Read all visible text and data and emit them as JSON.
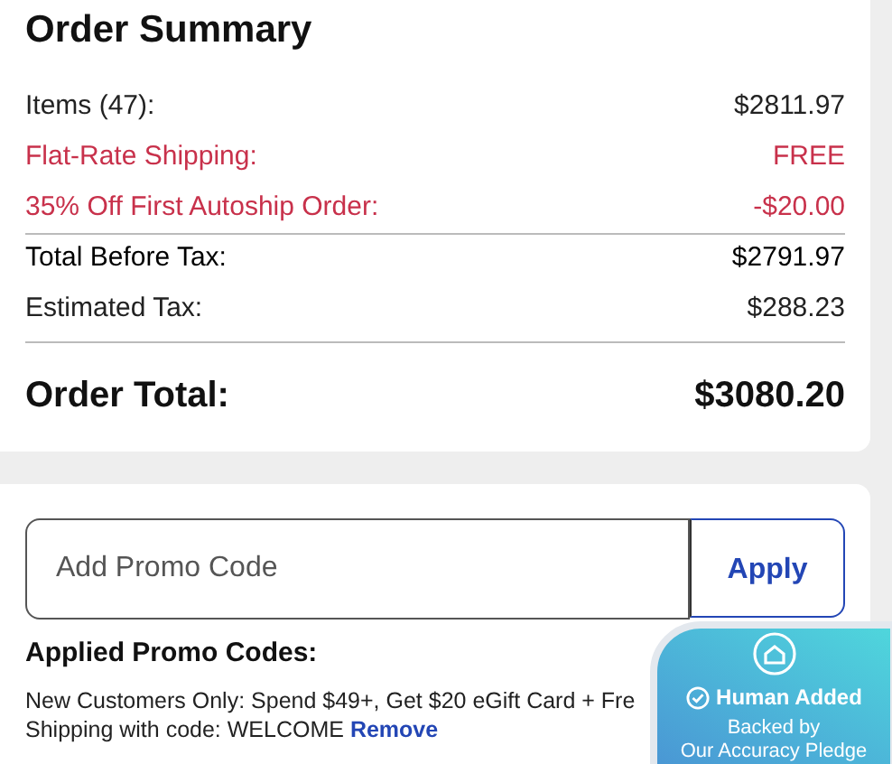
{
  "order_summary": {
    "title": "Order Summary",
    "lines": [
      {
        "label": "Items (47):",
        "value": "$2811.97",
        "kind": "plain"
      },
      {
        "label": "Flat-Rate Shipping:",
        "value": "FREE",
        "kind": "highlight"
      },
      {
        "label": "35% Off First Autoship Order:",
        "value": "-$20.00",
        "kind": "discount"
      },
      {
        "label": "Total Before Tax:",
        "value": "$2791.97",
        "kind": "plain"
      },
      {
        "label": "Estimated Tax:",
        "value": "$288.23",
        "kind": "plain"
      }
    ],
    "total": {
      "label": "Order Total:",
      "value": "$3080.20"
    }
  },
  "promo": {
    "placeholder": "Add Promo Code",
    "button": "Apply",
    "applied_title": "Applied Promo Codes:",
    "applied_text_line_1": "New Customers Only: Spend $49+, Get $20 eGift Card + Fre",
    "applied_text_line_2": "Shipping with code: WELCOME",
    "remove_link": "Remove"
  },
  "badge": {
    "title": "Human Added",
    "subtitle_line_1": "Backed by",
    "subtitle_line_2": "Our Accuracy Pledge"
  }
}
